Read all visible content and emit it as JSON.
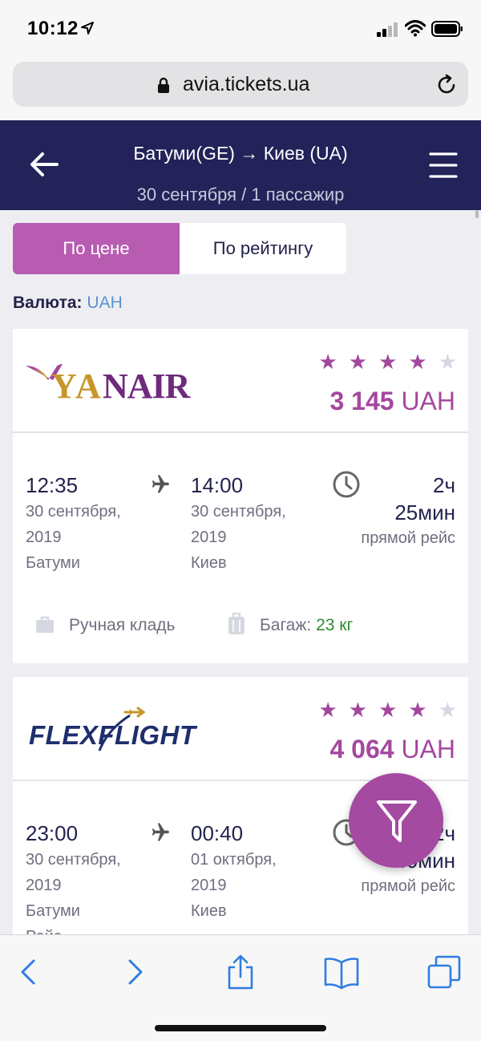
{
  "status_bar": {
    "time": "10:12"
  },
  "browser": {
    "url": "avia.tickets.ua"
  },
  "header": {
    "route": "Батуми(GE) → Киев (UA)",
    "subtitle": "30 сентября / 1 пассажир"
  },
  "sort": {
    "by_price": "По цене",
    "by_rating": "По рейтингу",
    "active": "by_price"
  },
  "currency": {
    "label": "Валюта:",
    "value": "UAH"
  },
  "colors": {
    "header_bg": "#23235a",
    "accent": "#a4489e",
    "active_tab": "#b85cb2",
    "link": "#5b8fd6",
    "baggage_value": "#2e8b2e"
  },
  "flights": [
    {
      "airline": "YANAIR",
      "logo_icon": "yanair-logo",
      "rating": 4,
      "rating_max": 5,
      "price_amount": "3 145",
      "price_currency": "UAH",
      "dep_time": "12:35",
      "dep_date_1": "30 сентября,",
      "dep_date_2": "2019",
      "dep_city": "Батуми",
      "arr_time": "14:00",
      "arr_date_1": "30 сентября,",
      "arr_date_2": "2019",
      "arr_city": "Киев",
      "duration_h": "2ч",
      "duration_m": "25мин",
      "flight_type": "прямой рейс",
      "hand_luggage": "Ручная кладь",
      "baggage_label": "Багаж:",
      "baggage_value": "23 кг"
    },
    {
      "airline": "FLEXFLIGHT",
      "logo_icon": "flexflight-logo",
      "rating": 4,
      "rating_max": 5,
      "price_amount": "4 064",
      "price_currency": "UAH",
      "dep_time": "23:00",
      "dep_date_1": "30 сентября,",
      "dep_date_2": "2019",
      "dep_city": "Батуми",
      "dep_extra": "Рейс",
      "arr_time": "00:40",
      "arr_date_1": "01 октября,",
      "arr_date_2": "2019",
      "arr_city": "Киев",
      "duration_h": "2ч",
      "duration_m": "40мин",
      "flight_type": "прямой рейс"
    }
  ]
}
